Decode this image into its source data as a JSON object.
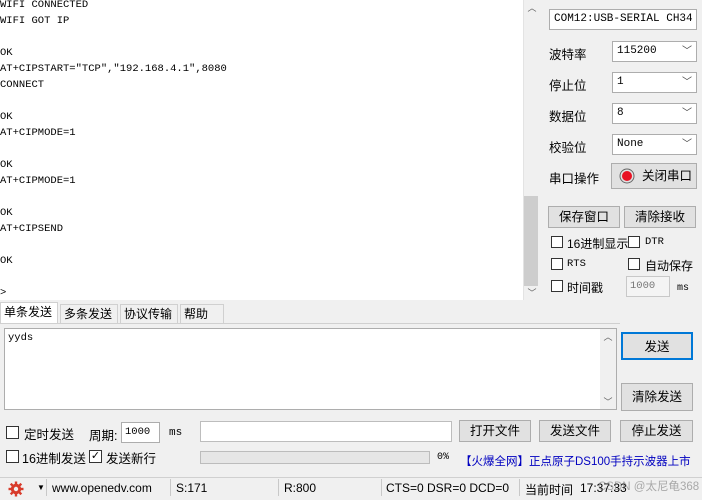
{
  "receive": {
    "lines": [
      "WIFI CONNECTED",
      "WIFI GOT IP",
      "",
      "OK",
      "AT+CIPSTART=\"TCP\",\"192.168.4.1\",8080",
      "CONNECT",
      "",
      "OK",
      "AT+CIPMODE=1",
      "",
      "OK",
      "AT+CIPMODE=1",
      "",
      "OK",
      "AT+CIPSEND",
      "",
      "OK",
      "",
      ">"
    ]
  },
  "serial": {
    "port": "COM12:USB-SERIAL CH34",
    "baud_label": "波特率",
    "baud_value": "115200",
    "stopbits_label": "停止位",
    "stopbits_value": "1",
    "databits_label": "数据位",
    "databits_value": "8",
    "parity_label": "校验位",
    "parity_value": "None",
    "op_label": "串口操作",
    "close_button": "关闭串口",
    "status_color": "#e81123"
  },
  "recv_options": {
    "save_window": "保存窗口",
    "clear_receive": "清除接收",
    "hex_display": "16进制显示",
    "dtr": "DTR",
    "rts": "RTS",
    "auto_save": "自动保存",
    "timestamp": "时间戳",
    "timestamp_value": "1000",
    "timestamp_unit": "ms"
  },
  "tabs": [
    "单条发送",
    "多条发送",
    "协议传输",
    "帮助"
  ],
  "send": {
    "text": "yyds",
    "send_button": "发送",
    "clear_send": "清除发送",
    "timed_send": "定时发送",
    "period_label": "周期:",
    "period_value": "1000",
    "period_unit": "ms",
    "open_file": "打开文件",
    "send_file": "发送文件",
    "stop_send": "停止发送",
    "hex_send": "16进制发送",
    "send_newline": "发送新行",
    "send_newline_checked": "✓",
    "progress_percent": 0,
    "progress_text": "0%",
    "ad_text": "【火爆全网】正点原子DS100手持示波器上市",
    "ad_color": "#0000c0"
  },
  "statusbar": {
    "url": "www.openedv.com",
    "sent": "S:171",
    "received": "R:800",
    "lines": "CTS=0 DSR=0 DCD=0",
    "time_label": "当前时间",
    "time_value": "17:37:33",
    "watermark": "CSDN @太尼龟368"
  }
}
